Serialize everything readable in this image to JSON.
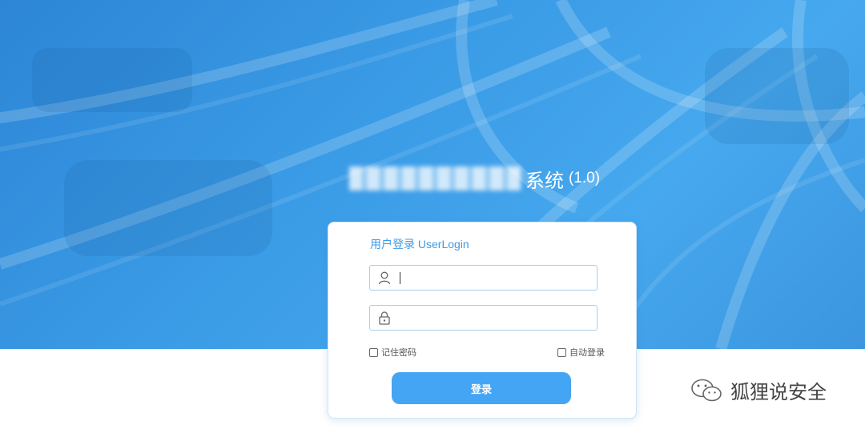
{
  "header": {
    "title_suffix": "系统",
    "version": "(1.0)"
  },
  "login": {
    "title": "用户登录 UserLogin",
    "username": {
      "value": "",
      "icon": "user-icon"
    },
    "password": {
      "value": "",
      "icon": "lock-icon"
    },
    "remember_label": "记住密码",
    "auto_login_label": "自动登录",
    "submit_label": "登录"
  },
  "watermark": {
    "text": "狐狸说安全",
    "icon": "wechat-icon"
  },
  "colors": {
    "accent": "#45a5f5",
    "title_blue": "#3d9be9",
    "hero": "#3a9be6"
  }
}
